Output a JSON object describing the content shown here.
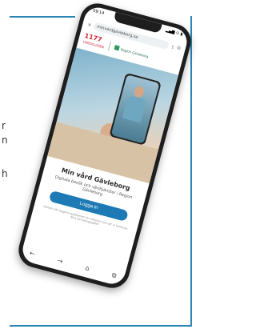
{
  "side_text": [
    "r",
    "n",
    "h"
  ],
  "phone": {
    "status": {
      "time": "09:14",
      "indicators": "▂▄▆ ⊙ ▮"
    },
    "browser": {
      "url": "minvardgavleborg.se",
      "icons": [
        "close-icon",
        "tab-icon",
        "share-icon"
      ]
    },
    "brand": {
      "logo_1177": "1177",
      "logo_1177_sub": "VÅRDGUIDEN",
      "region_name": "Region Gävleborg"
    },
    "main": {
      "title": "Min vård Gävleborg",
      "subtitle": "Digitala besök och vårdtjänster i Region Gävleborg",
      "login_label": "Logga in",
      "footnote": "Genom att logga in godkänner du villkoren och att vi hanterar dina personuppgifter"
    },
    "bottom_bar": {
      "back": "←",
      "forward": "→",
      "home": "⌂",
      "tabs": "⧉"
    }
  }
}
